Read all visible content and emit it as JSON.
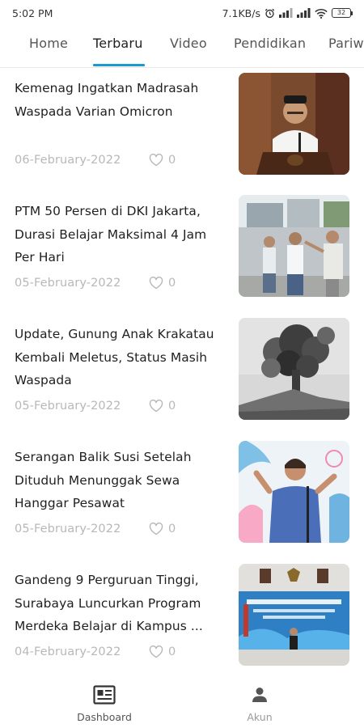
{
  "status_bar": {
    "time": "5:02 PM",
    "network_speed": "7.1KB/s",
    "battery": "32",
    "icons": [
      "alarm-icon",
      "signal-icon",
      "signal-icon",
      "wifi-icon",
      "battery-icon"
    ]
  },
  "tabs": [
    {
      "label": "Home",
      "active": false
    },
    {
      "label": "Terbaru",
      "active": true
    },
    {
      "label": "Video",
      "active": false
    },
    {
      "label": "Pendidikan",
      "active": false
    },
    {
      "label": "Pariw",
      "active": false
    }
  ],
  "articles": [
    {
      "title": "Kemenag Ingatkan Madrasah Waspada Varian Omicron",
      "date": "06-February-2022",
      "likes": "0",
      "like_icon": "heart-outline-icon"
    },
    {
      "title": "PTM 50 Persen di DKI Jakarta, Durasi Belajar Maksimal 4 Jam Per Hari",
      "date": "05-February-2022",
      "likes": "0",
      "like_icon": "heart-outline-icon"
    },
    {
      "title": "Update, Gunung Anak Krakatau Kembali Meletus, Status Masih Waspada",
      "date": "05-February-2022",
      "likes": "0",
      "like_icon": "heart-outline-icon"
    },
    {
      "title": "Serangan Balik Susi Setelah Dituduh Menunggak Sewa Hanggar Pesawat",
      "date": "05-February-2022",
      "likes": "0",
      "like_icon": "heart-outline-icon"
    },
    {
      "title": "Gandeng 9 Perguruan Tinggi, Surabaya Luncurkan Program Merdeka Belajar di Kampus ...",
      "date": "04-February-2022",
      "likes": "0",
      "like_icon": "heart-outline-icon"
    }
  ],
  "bottom_nav": [
    {
      "label": "Dashboard",
      "icon": "newspaper-icon",
      "active": true
    },
    {
      "label": "Akun",
      "icon": "person-icon",
      "active": false
    }
  ],
  "colors": {
    "accent": "#1a9bcf",
    "text": "#1f1f1f",
    "muted": "#b8b8b8"
  }
}
